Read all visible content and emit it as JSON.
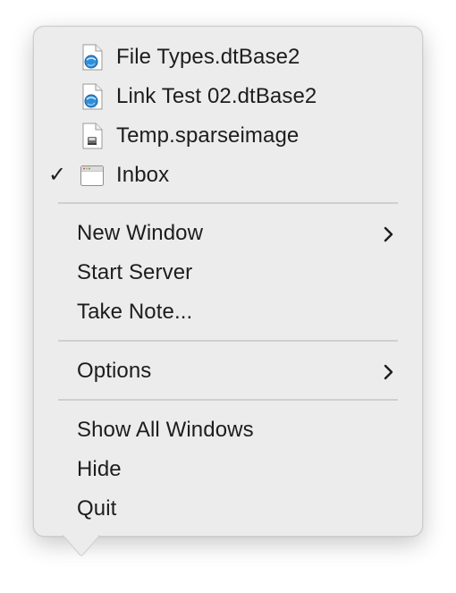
{
  "menu": {
    "documents": [
      {
        "label": "File Types.dtBase2",
        "icon": "database-document-icon",
        "checked": false
      },
      {
        "label": "Link Test 02.dtBase2",
        "icon": "database-document-icon",
        "checked": false
      },
      {
        "label": "Temp.sparseimage",
        "icon": "disk-image-document-icon",
        "checked": false
      },
      {
        "label": "Inbox",
        "icon": "window-icon",
        "checked": true
      }
    ],
    "check_mark": "✓",
    "window_items": [
      {
        "label": "New Window",
        "has_submenu": true
      },
      {
        "label": "Start Server",
        "has_submenu": false
      },
      {
        "label": "Take Note...",
        "has_submenu": false
      }
    ],
    "options_items": [
      {
        "label": "Options",
        "has_submenu": true
      }
    ],
    "app_items": [
      {
        "label": "Show All Windows"
      },
      {
        "label": "Hide"
      },
      {
        "label": "Quit"
      }
    ]
  },
  "colors": {
    "menu_background": "#ececec",
    "text": "#1d1d1d",
    "separator": "#cfcfcf",
    "database_icon_accent": "#2f8fd8"
  }
}
